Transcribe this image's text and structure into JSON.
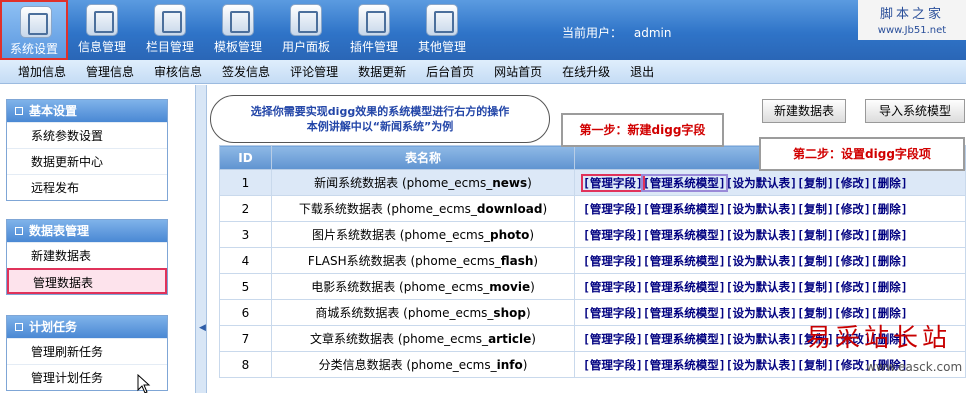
{
  "top_menu": [
    {
      "label": "系统设置",
      "icon": "wrench-icon",
      "active": true
    },
    {
      "label": "信息管理",
      "icon": "document-icon"
    },
    {
      "label": "栏目管理",
      "icon": "column-icon"
    },
    {
      "label": "模板管理",
      "icon": "template-icon"
    },
    {
      "label": "用户面板",
      "icon": "users-icon"
    },
    {
      "label": "插件管理",
      "icon": "lifebuoy-icon"
    },
    {
      "label": "其他管理",
      "icon": "play-icon"
    }
  ],
  "current_user": {
    "label": "当前用户：",
    "name": "admin"
  },
  "logo": {
    "line1": "脚本之家",
    "line2": "www.Jb51.net"
  },
  "sub_menu": [
    "增加信息",
    "管理信息",
    "审核信息",
    "签发信息",
    "评论管理",
    "数据更新",
    "后台首页",
    "网站首页",
    "在线升级",
    "退出"
  ],
  "sidebar": {
    "sections": [
      {
        "title": "基本设置",
        "items": [
          "系统参数设置",
          "数据更新中心",
          "远程发布"
        ]
      },
      {
        "title": "数据表管理",
        "items": [
          "新建数据表",
          "管理数据表"
        ]
      },
      {
        "title": "计划任务",
        "items": [
          "管理刷新任务",
          "管理计划任务"
        ]
      }
    ]
  },
  "main": {
    "tip": {
      "line1": "选择你需要实现digg效果的系统模型进行右方的操作",
      "line2": "本例讲解中以“新闻系统”为例"
    },
    "new_table_button": "新建数据表",
    "import_model_button": "导入系统模型",
    "callout_step1": "第一步：新建digg字段",
    "callout_step2": "第二步：设置digg字段项",
    "table": {
      "headers": [
        "ID",
        "表名称",
        ""
      ],
      "rows": [
        {
          "id": "1",
          "name_prefix": "新闻系统数据表 (phome_ecms_",
          "name_bold": "news",
          "name_suffix": ")"
        },
        {
          "id": "2",
          "name_prefix": "下载系统数据表 (phome_ecms_",
          "name_bold": "download",
          "name_suffix": ")"
        },
        {
          "id": "3",
          "name_prefix": "图片系统数据表 (phome_ecms_",
          "name_bold": "photo",
          "name_suffix": ")"
        },
        {
          "id": "4",
          "name_prefix": "FLASH系统数据表 (phome_ecms_",
          "name_bold": "flash",
          "name_suffix": ")"
        },
        {
          "id": "5",
          "name_prefix": "电影系统数据表 (phome_ecms_",
          "name_bold": "movie",
          "name_suffix": ")"
        },
        {
          "id": "6",
          "name_prefix": "商城系统数据表 (phome_ecms_",
          "name_bold": "shop",
          "name_suffix": ")"
        },
        {
          "id": "7",
          "name_prefix": "文章系统数据表 (phome_ecms_",
          "name_bold": "article",
          "name_suffix": ")"
        },
        {
          "id": "8",
          "name_prefix": "分类信息数据表 (phome_ecms_",
          "name_bold": "info",
          "name_suffix": ")"
        }
      ],
      "ops": [
        "[管理字段]",
        "[管理系统模型]",
        "[设为默认表]",
        "[复制]",
        "[修改]",
        "[删除]"
      ]
    }
  },
  "watermark": {
    "text": "易采站长站",
    "url": "www.easck.com"
  }
}
